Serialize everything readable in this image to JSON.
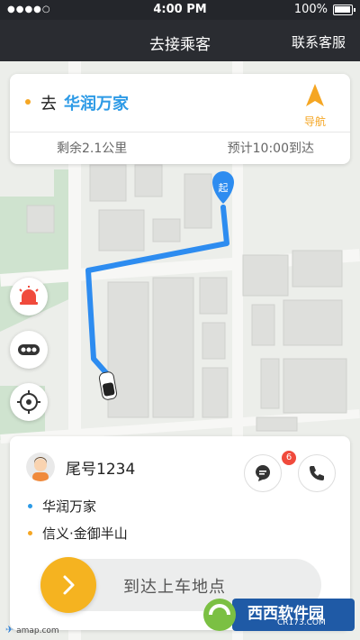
{
  "status_bar": {
    "signal": "●●●●○",
    "carrier": "",
    "time": "4:00 PM",
    "battery": "100%"
  },
  "navbar": {
    "title": "去接乘客",
    "service": "联系客服"
  },
  "destination_card": {
    "prefix": "去",
    "destination": "华润万家",
    "nav_label": "导航",
    "remaining": "剩余2.1公里",
    "eta": "预计10:00到达"
  },
  "map": {
    "start_marker": "起",
    "route_color": "#2d8cf0",
    "icons": [
      "alarm-icon",
      "traffic-icon",
      "locate-icon",
      "car-icon"
    ]
  },
  "passenger_card": {
    "tail_number": "尾号1234",
    "message_badge": "6",
    "pickup": "华润万家",
    "dropoff": "信义·金御半山",
    "pickup_color": "#2c9ae6",
    "dropoff_color": "#f5a623",
    "swipe_label": "到达上车地点"
  },
  "branding": {
    "amap_logo": "amap.com",
    "watermark_main": "西西软件园",
    "watermark_sub": "CR173.COM"
  },
  "colors": {
    "accent_orange": "#f5b320",
    "accent_blue": "#2c9ae6",
    "alarm_red": "#f04a3c"
  }
}
